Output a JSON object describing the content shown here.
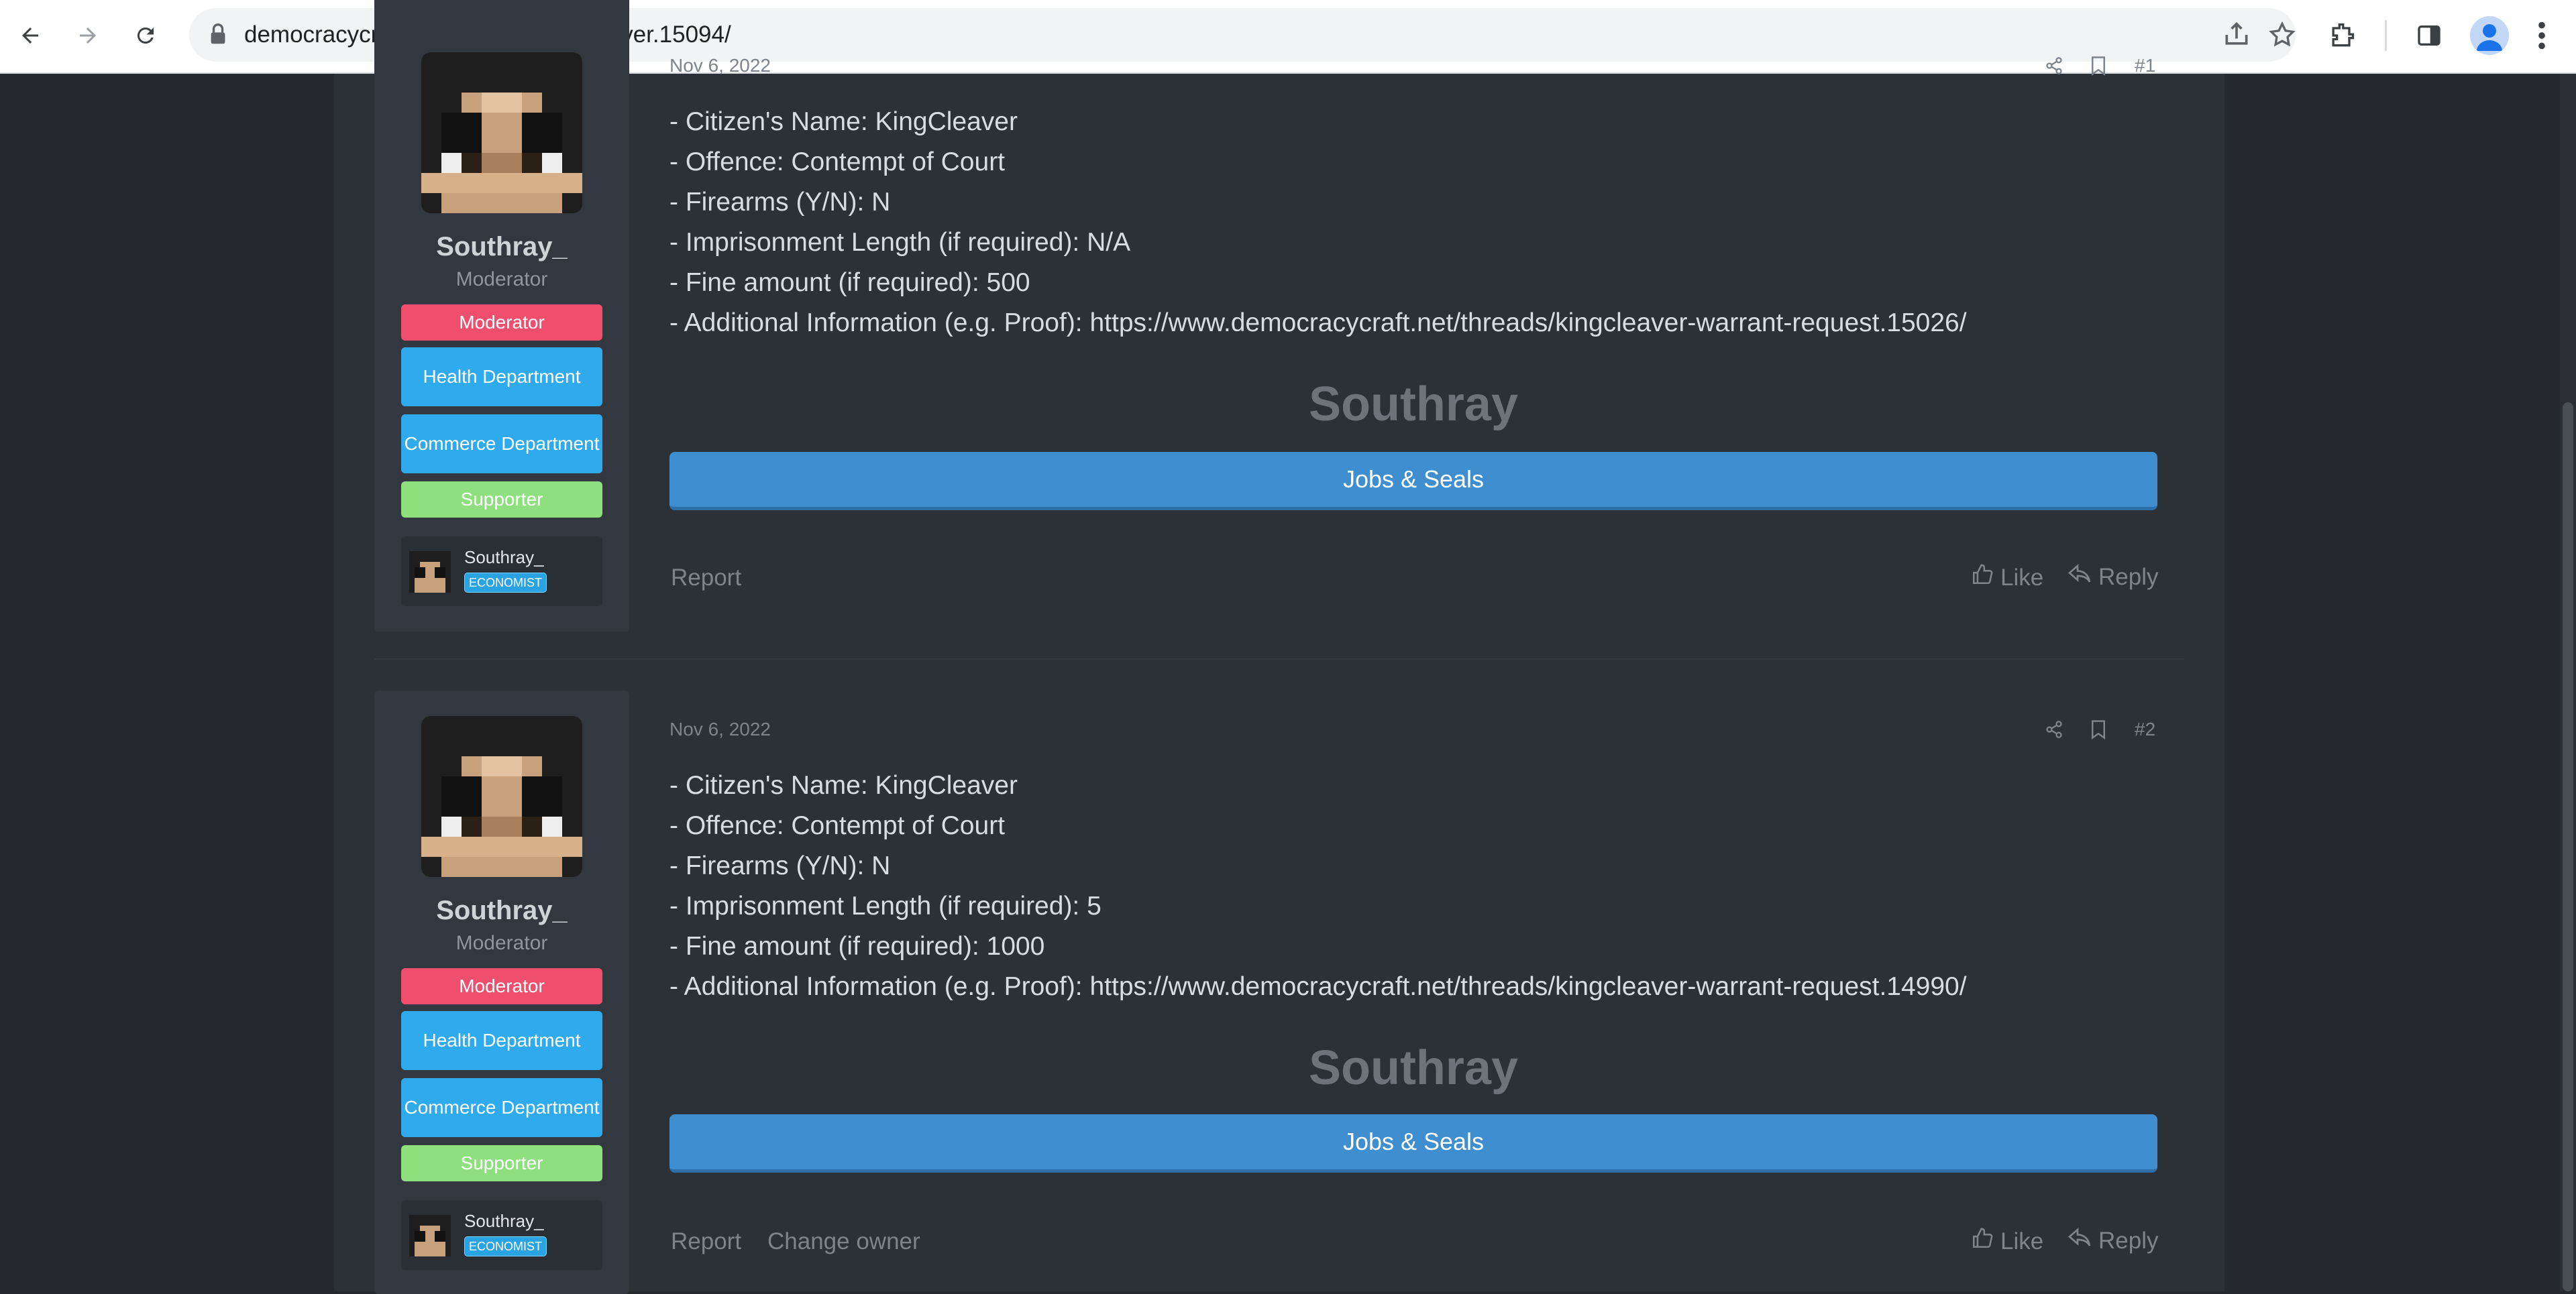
{
  "browser": {
    "url": "democracycraft.net/threads/kingcleaver.15094/",
    "icons": [
      "back-icon",
      "forward-icon",
      "reload-icon",
      "lock-icon",
      "share-icon",
      "star-icon",
      "extensions-icon",
      "side-panel-icon",
      "profile-icon",
      "menu-icon"
    ]
  },
  "posts": [
    {
      "date": "Nov 6, 2022",
      "number": "#1",
      "user": {
        "name": "Southray_",
        "title": "Moderator",
        "banners": [
          "Moderator",
          "Health Department",
          "Commerce Department",
          "Supporter"
        ],
        "mini_name": "Southray_",
        "mini_badge": "ECONOMIST"
      },
      "lines": [
        "- Citizen's Name: KingCleaver",
        "- Offence: Contempt of Court",
        "- Firearms (Y/N): N",
        "- Imprisonment Length (if required): N/A",
        "- Fine amount (if required): 500",
        "- Additional Information (e.g. Proof): https://www.democracycraft.net/threads/kingcleaver-warrant-request.15026/"
      ],
      "signature_name": "Southray",
      "signature_button": "Jobs & Seals",
      "actions": {
        "report": "Report",
        "change_owner": "",
        "like": "Like",
        "reply": "Reply"
      }
    },
    {
      "date": "Nov 6, 2022",
      "number": "#2",
      "user": {
        "name": "Southray_",
        "title": "Moderator",
        "banners": [
          "Moderator",
          "Health Department",
          "Commerce Department",
          "Supporter"
        ],
        "mini_name": "Southray_",
        "mini_badge": "ECONOMIST"
      },
      "lines": [
        "- Citizen's Name: KingCleaver",
        "- Offence: Contempt of Court",
        "- Firearms (Y/N): N",
        "- Imprisonment Length (if required): 5",
        "- Fine amount (if required): 1000",
        "- Additional Information (e.g. Proof): https://www.democracycraft.net/threads/kingcleaver-warrant-request.14990/"
      ],
      "signature_name": "Southray",
      "signature_button": "Jobs & Seals",
      "actions": {
        "report": "Report",
        "change_owner": "Change owner",
        "like": "Like",
        "reply": "Reply"
      }
    }
  ],
  "colors": {
    "page_bg": "#262a2f",
    "content_bg": "#2c3138",
    "moderator_banner": "#ef4e6d",
    "department_banner": "#2eaaed",
    "supporter_banner": "#8ee07f",
    "signature_button": "#3f8ed0"
  }
}
